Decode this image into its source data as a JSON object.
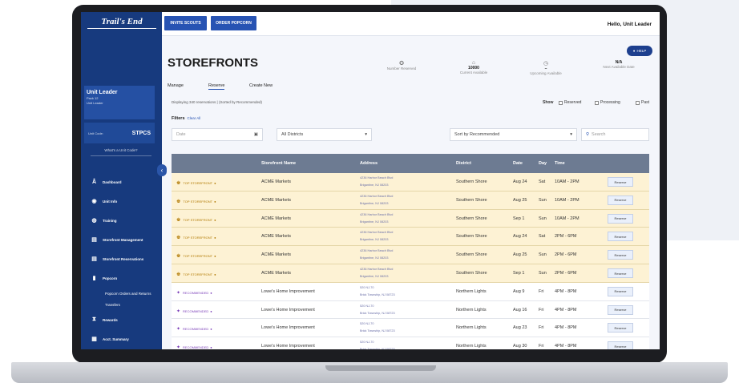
{
  "sidebar": {
    "logo": "Trail's End",
    "user_title": "Unit Leader",
    "user_pack": "Pack 12",
    "user_role": "Unit Leader",
    "unit_code_label": "Unit Code:",
    "unit_code_value": "STPCS",
    "what_link": "What's a Unit Code?",
    "nav": [
      {
        "label": "Dashboard",
        "icon": "hiker-icon"
      },
      {
        "label": "Unit Info",
        "icon": "people-icon"
      },
      {
        "label": "Training",
        "icon": "graduation-icon"
      },
      {
        "label": "Storefront Management",
        "icon": "store-icon"
      },
      {
        "label": "Storefront Reservations",
        "icon": "store-icon"
      },
      {
        "label": "Popcorn",
        "icon": "popcorn-icon"
      }
    ],
    "sub_nav": [
      "Popcorn Orders and Returns",
      "Transfers"
    ],
    "nav_bottom": [
      {
        "label": "Rewards",
        "icon": "trophy-icon"
      },
      {
        "label": "Acct. Summary",
        "icon": "receipt-icon"
      }
    ]
  },
  "topbar": {
    "invite_label": "INVITE SCOUTS",
    "order_label": "ORDER POPCORN",
    "greeting": "Hello, Unit Leader"
  },
  "page": {
    "title": "STOREFRONTS",
    "help_label": "HELP",
    "stats": [
      {
        "value": "",
        "label": "Number Reserved",
        "icon": "badge-icon"
      },
      {
        "value": "10000",
        "label": "Current Available",
        "icon": "store-icon"
      },
      {
        "value": "–",
        "label": "Upcoming Available",
        "icon": "clock-icon"
      },
      {
        "value": "N/A",
        "label": "Next Available Date",
        "icon": "calendar-icon"
      }
    ],
    "tabs": [
      "Manage",
      "Reserve",
      "Create New"
    ],
    "active_tab": "Reserve",
    "displaying": "Displaying 340 reservations | (Sorted by Recommended)",
    "show_label": "Show",
    "show_options": [
      "Reserved",
      "Processing",
      "Past"
    ],
    "filters_label": "Filters",
    "clear_all": "Clear All",
    "date_placeholder": "Date",
    "district_value": "All Districts",
    "sort_value": "Sort by Recommended",
    "search_placeholder": "Search"
  },
  "table": {
    "headers": [
      "Storefront Name",
      "Address",
      "District",
      "Date",
      "Day",
      "Time"
    ],
    "reserve_label": "Reserve",
    "rows": [
      {
        "tag": "TOP STOREFRONT",
        "kind": "top",
        "name": "ACME Markets",
        "addr1": "4236 Harbor Beach Blvd",
        "addr2": "Brigantine, NJ 08203",
        "district": "Southern Shore",
        "date": "Aug 24",
        "day": "Sat",
        "time": "10AM - 2PM"
      },
      {
        "tag": "TOP STOREFRONT",
        "kind": "top",
        "name": "ACME Markets",
        "addr1": "4236 Harbor Beach Blvd",
        "addr2": "Brigantine, NJ 08203",
        "district": "Southern Shore",
        "date": "Aug 25",
        "day": "Sun",
        "time": "10AM - 2PM"
      },
      {
        "tag": "TOP STOREFRONT",
        "kind": "top",
        "name": "ACME Markets",
        "addr1": "4236 Harbor Beach Blvd",
        "addr2": "Brigantine, NJ 08203",
        "district": "Southern Shore",
        "date": "Sep 1",
        "day": "Sun",
        "time": "10AM - 2PM"
      },
      {
        "tag": "TOP STOREFRONT",
        "kind": "top",
        "name": "ACME Markets",
        "addr1": "4236 Harbor Beach Blvd",
        "addr2": "Brigantine, NJ 08203",
        "district": "Southern Shore",
        "date": "Aug 24",
        "day": "Sat",
        "time": "2PM - 6PM"
      },
      {
        "tag": "TOP STOREFRONT",
        "kind": "top",
        "name": "ACME Markets",
        "addr1": "4236 Harbor Beach Blvd",
        "addr2": "Brigantine, NJ 08203",
        "district": "Southern Shore",
        "date": "Aug 25",
        "day": "Sun",
        "time": "2PM - 6PM"
      },
      {
        "tag": "TOP STOREFRONT",
        "kind": "top",
        "name": "ACME Markets",
        "addr1": "4236 Harbor Beach Blvd",
        "addr2": "Brigantine, NJ 08203",
        "district": "Southern Shore",
        "date": "Sep 1",
        "day": "Sun",
        "time": "2PM - 6PM"
      },
      {
        "tag": "RECOMMENDED",
        "kind": "rec",
        "name": "Lowe's Home Improvement",
        "addr1": "520 NJ-70",
        "addr2": "Brick Township, NJ 08723",
        "district": "Northern Lights",
        "date": "Aug 9",
        "day": "Fri",
        "time": "4PM - 8PM"
      },
      {
        "tag": "RECOMMENDED",
        "kind": "rec",
        "name": "Lowe's Home Improvement",
        "addr1": "520 NJ-70",
        "addr2": "Brick Township, NJ 08723",
        "district": "Northern Lights",
        "date": "Aug 16",
        "day": "Fri",
        "time": "4PM - 8PM"
      },
      {
        "tag": "RECOMMENDED",
        "kind": "rec",
        "name": "Lowe's Home Improvement",
        "addr1": "520 NJ-70",
        "addr2": "Brick Township, NJ 08723",
        "district": "Northern Lights",
        "date": "Aug 23",
        "day": "Fri",
        "time": "4PM - 8PM"
      },
      {
        "tag": "RECOMMENDED",
        "kind": "rec",
        "name": "Lowe's Home Improvement",
        "addr1": "520 NJ-70",
        "addr2": "Brick Township, NJ 08723",
        "district": "Northern Lights",
        "date": "Aug 30",
        "day": "Fri",
        "time": "4PM - 8PM"
      }
    ]
  },
  "colors": {
    "sidebar": "#173a7e",
    "accent": "#2753b3",
    "top_row": "#fdf2d4",
    "header": "#6d7b92"
  }
}
